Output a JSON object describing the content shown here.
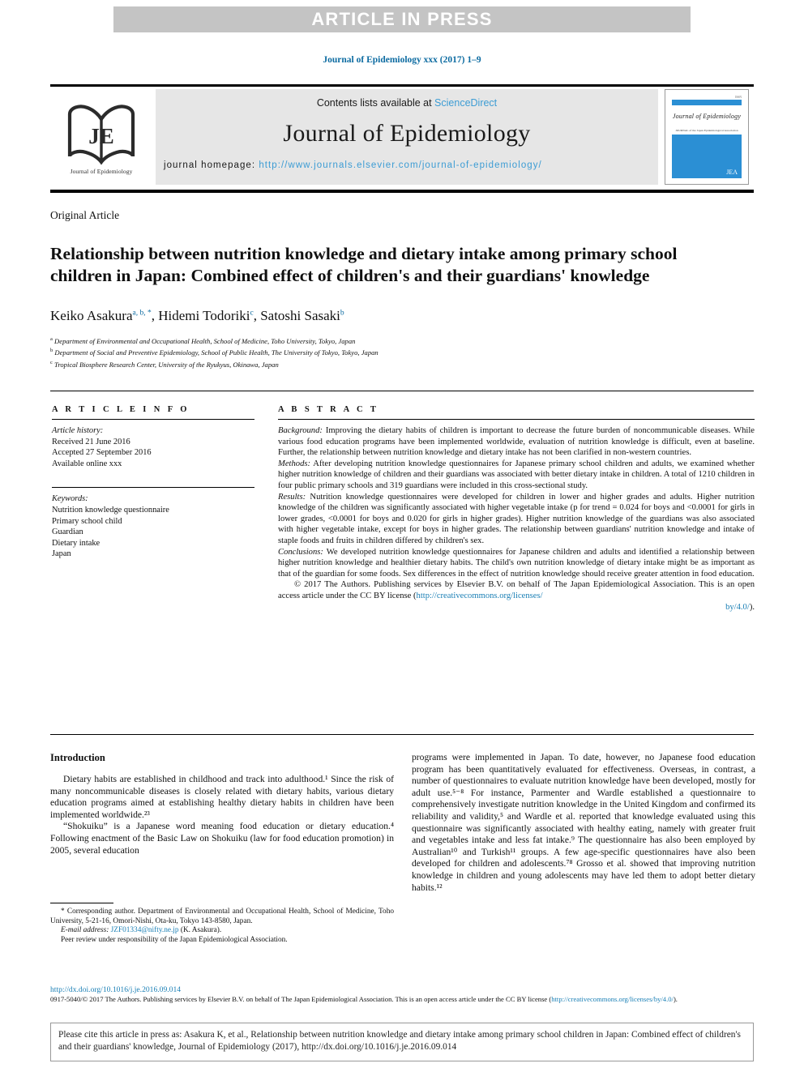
{
  "banner": {
    "text": "ARTICLE IN PRESS"
  },
  "journal_citation": "Journal of Epidemiology xxx (2017) 1–9",
  "masthead": {
    "contents_prefix": "Contents lists available at ",
    "sciencedirect": "ScienceDirect",
    "journal_name": "Journal of Epidemiology",
    "homepage_prefix": "journal homepage: ",
    "homepage_url": "http://www.journals.elsevier.com/journal-of-epidemiology/",
    "logo_caption": "Journal of Epidemiology",
    "logo_letters": "JE",
    "cover": {
      "top_number": "ISSN",
      "title": "Journal of Epidemiology",
      "mini_line": "JOURNAL of the Japan Epidemiological Association",
      "mark": "JEA"
    }
  },
  "article": {
    "type": "Original Article",
    "title": "Relationship between nutrition knowledge and dietary intake among primary school children in Japan: Combined effect of children's and their guardians' knowledge",
    "authors": [
      {
        "name": "Keiko Asakura",
        "marks": "a, b, *"
      },
      {
        "name": "Hidemi Todoriki",
        "marks": "c"
      },
      {
        "name": "Satoshi Sasaki",
        "marks": "b"
      }
    ],
    "affiliations": [
      {
        "mark": "a",
        "text": "Department of Environmental and Occupational Health, School of Medicine, Toho University, Tokyo, Japan"
      },
      {
        "mark": "b",
        "text": "Department of Social and Preventive Epidemiology, School of Public Health, The University of Tokyo, Tokyo, Japan"
      },
      {
        "mark": "c",
        "text": "Tropical Biosphere Research Center, University of the Ryukyus, Okinawa, Japan"
      }
    ]
  },
  "article_info": {
    "heading": "A R T I C L E   I N F O",
    "history_label": "Article history:",
    "history": [
      "Received 21 June 2016",
      "Accepted 27 September 2016",
      "Available online xxx"
    ],
    "keywords_label": "Keywords:",
    "keywords": [
      "Nutrition knowledge questionnaire",
      "Primary school child",
      "Guardian",
      "Dietary intake",
      "Japan"
    ]
  },
  "abstract": {
    "heading": "A B S T R A C T",
    "background_label": "Background:",
    "background": " Improving the dietary habits of children is important to decrease the future burden of noncommunicable diseases. While various food education programs have been implemented worldwide, evaluation of nutrition knowledge is difficult, even at baseline. Further, the relationship between nutrition knowledge and dietary intake has not been clarified in non-western countries.",
    "methods_label": "Methods:",
    "methods": " After developing nutrition knowledge questionnaires for Japanese primary school children and adults, we examined whether higher nutrition knowledge of children and their guardians was associated with better dietary intake in children. A total of 1210 children in four public primary schools and 319 guardians were included in this cross-sectional study.",
    "results_label": "Results:",
    "results": " Nutrition knowledge questionnaires were developed for children in lower and higher grades and adults. Higher nutrition knowledge of the children was significantly associated with higher vegetable intake (p for trend = 0.024 for boys and <0.0001 for girls in lower grades, <0.0001 for boys and 0.020 for girls in higher grades). Higher nutrition knowledge of the guardians was also associated with higher vegetable intake, except for boys in higher grades. The relationship between guardians' nutrition knowledge and intake of staple foods and fruits in children differed by children's sex.",
    "conclusions_label": "Conclusions:",
    "conclusions": " We developed nutrition knowledge questionnaires for Japanese children and adults and identified a relationship between higher nutrition knowledge and healthier dietary habits. The child's own nutrition knowledge of dietary intake might be as important as that of the guardian for some foods. Sex differences in the effect of nutrition knowledge should receive greater attention in food education.",
    "copyright": "© 2017 The Authors. Publishing services by Elsevier B.V. on behalf of The Japan Epidemiological Association. This is an open access article under the CC BY license (",
    "license_url_part1": "http://creativecommons.org/licenses/",
    "license_url_part2": "by/4.0/",
    "copyright_tail": ")."
  },
  "body": {
    "intro_heading": "Introduction",
    "left_paragraphs": [
      "Dietary habits are established in childhood and track into adulthood.¹ Since the risk of many noncommunicable diseases is closely related with dietary habits, various dietary education programs aimed at establishing healthy dietary habits in children have been implemented worldwide.²³",
      "“Shokuiku” is a Japanese word meaning food education or dietary education.⁴ Following enactment of the Basic Law on Shokuiku (law for food education promotion) in 2005, several education"
    ],
    "right_paragraphs": [
      "programs were implemented in Japan. To date, however, no Japanese food education program has been quantitatively evaluated for effectiveness. Overseas, in contrast, a number of questionnaires to evaluate nutrition knowledge have been developed, mostly for adult use.⁵⁻⁸ For instance, Parmenter and Wardle established a questionnaire to comprehensively investigate nutrition knowledge in the United Kingdom and confirmed its reliability and validity,⁵ and Wardle et al. reported that knowledge evaluated using this questionnaire was significantly associated with healthy eating, namely with greater fruit and vegetables intake and less fat intake.⁹ The questionnaire has also been employed by Australian¹⁰ and Turkish¹¹ groups. A few age-specific questionnaires have also been developed for children and adolescents.⁷⁸ Grosso et al. showed that improving nutrition knowledge in children and young adolescents may have led them to adopt better dietary habits.¹²"
    ]
  },
  "footnotes": {
    "corresponding": "* Corresponding author. Department of Environmental and Occupational Health, School of Medicine, Toho University, 5-21-16, Omori-Nishi, Ota-ku, Tokyo 143-8580, Japan.",
    "email_label": "E-mail address:",
    "email": "JZF01334@nifty.ne.jp",
    "email_tail": " (K. Asakura).",
    "peer_review": "Peer review under responsibility of the Japan Epidemiological Association."
  },
  "bottom": {
    "doi": "http://dx.doi.org/10.1016/j.je.2016.09.014",
    "copyright": "0917-5040/© 2017 The Authors. Publishing services by Elsevier B.V. on behalf of The Japan Epidemiological Association. This is an open access article under the CC BY license (",
    "license_url": "http://creativecommons.org/licenses/by/4.0/",
    "copyright_tail": ")."
  },
  "cite_box": {
    "text": "Please cite this article in press as: Asakura K, et al., Relationship between nutrition knowledge and dietary intake among primary school children in Japan: Combined effect of children's and their guardians' knowledge, Journal of Epidemiology (2017), http://dx.doi.org/10.1016/j.je.2016.09.014"
  },
  "colors": {
    "link_blue": "#1a7fb5",
    "cite_blue": "#0c6ba1",
    "sciencedirect_blue": "#3c9cd4",
    "banner_gray": "#c4c4c4",
    "masthead_gray": "#e6e6e6"
  }
}
